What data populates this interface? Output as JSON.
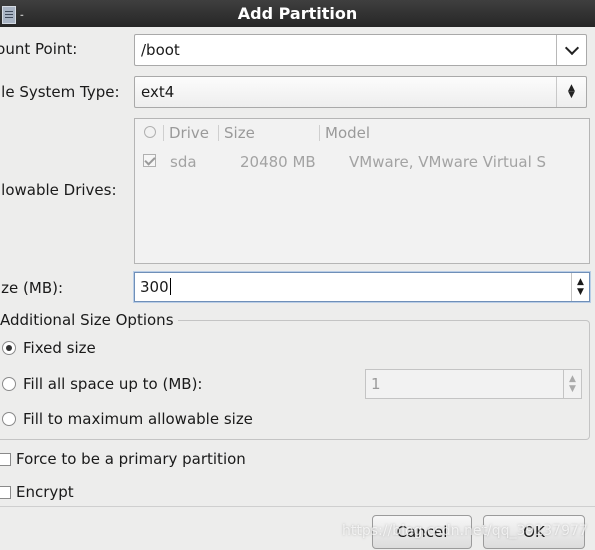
{
  "window": {
    "title": "Add Partition",
    "icon": "document-icon",
    "menu_glyph": "-"
  },
  "mount_point": {
    "label": "lount Point:",
    "value": "/boot",
    "icon": "chevron-down-icon"
  },
  "fs_type": {
    "label": "ile System Type:",
    "value": "ext4",
    "icon": "up-down-icon"
  },
  "drives": {
    "label": "llowable Drives:",
    "columns": [
      "Drive",
      "Size",
      "Model"
    ],
    "rows": [
      {
        "checked": true,
        "drive": "sda",
        "size": "20480 MB",
        "model": "VMware, VMware Virtual S"
      }
    ]
  },
  "size": {
    "label": "ize (MB):",
    "value": "300"
  },
  "size_options": {
    "title": "Additional Size Options",
    "fixed_label": "Fixed size",
    "fill_up_label": "Fill all space up to (MB):",
    "fill_up_value": "1",
    "fill_max_label": "Fill to maximum allowable size",
    "selected": "fixed"
  },
  "force_primary": {
    "label": "Force to be a primary partition",
    "checked": false
  },
  "encrypt": {
    "label": "Encrypt",
    "checked": false
  },
  "buttons": {
    "cancel": "Cancel",
    "ok": "OK"
  },
  "watermark": "https://blog.csdn.net/qq_39137977"
}
